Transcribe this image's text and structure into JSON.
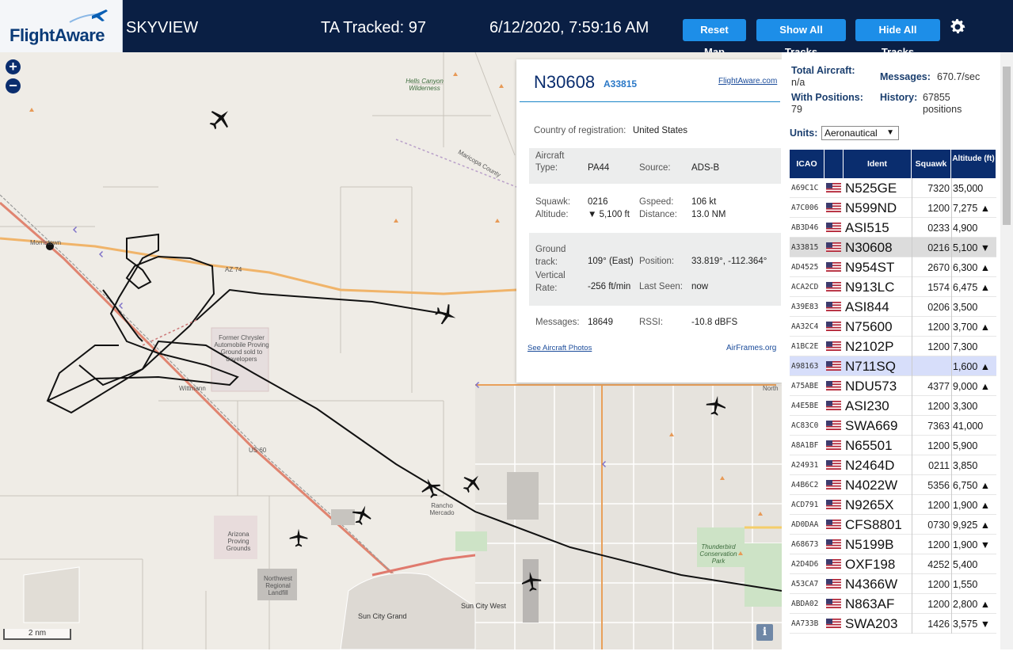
{
  "header": {
    "logo_text": "FlightAware",
    "app_name": "SKYVIEW",
    "tracked": "TA Tracked: 97",
    "datetime": "6/12/2020, 7:59:16 AM",
    "reset_map": "Reset Map",
    "show_all": "Show All Tracks",
    "hide_all": "Hide All Tracks"
  },
  "map": {
    "zoom_in": "+",
    "zoom_out": "−",
    "scale_label": "2 nm",
    "info_label": "i",
    "labels": {
      "hells_canyon": "Hells Canyon Wilderness",
      "morristown": "Morristown",
      "az74": "AZ 74",
      "proving_ground": "Former Chrysler Automobile Proving Ground sold to developers",
      "wittmann": "Wittmann",
      "us60": "US 60",
      "arizona_proving": "Arizona Proving Grounds",
      "rancho": "Rancho Mercado",
      "northwest_park": "Northwest Regional Landfill",
      "sun_city_grand": "Sun City Grand",
      "sun_city_west": "Sun City West",
      "thunderbird": "Thunderbird Conservation Park",
      "north": "North",
      "maricopa": "Maricopa County"
    }
  },
  "popup": {
    "ident": "N30608",
    "hex": "A33815",
    "fa_link": "FlightAware.com",
    "country_label": "Country of registration:",
    "country": "United States",
    "aircraft_type_label": "Aircraft Type:",
    "aircraft_type": "PA44",
    "source_label": "Source:",
    "source": "ADS-B",
    "squawk_label": "Squawk:",
    "squawk": "0216",
    "gspeed_label": "Gspeed:",
    "gspeed": "106 kt",
    "altitude_label": "Altitude:",
    "altitude": "▼ 5,100 ft",
    "distance_label": "Distance:",
    "distance": "13.0 NM",
    "ground_track_label": "Ground track:",
    "ground_track": "109° (East)",
    "position_label": "Position:",
    "position": "33.819°, -112.364°",
    "vertical_rate_label": "Vertical Rate:",
    "vertical_rate": "-256 ft/min",
    "last_seen_label": "Last Seen:",
    "last_seen": "now",
    "messages_label": "Messages:",
    "messages": "18649",
    "rssi_label": "RSSI:",
    "rssi": "-10.8 dBFS",
    "photos_link": "See Aircraft Photos",
    "airframes_link": "AirFrames.org"
  },
  "stats": {
    "total_label": "Total Aircraft:",
    "total_value": "n/a",
    "messages_label": "Messages:",
    "messages_value": "670.7/sec",
    "positions_label": "With Positions:",
    "positions_value": "79",
    "history_label": "History:",
    "history_value": "67855 positions",
    "units_label": "Units:",
    "units_value": "Aeronautical"
  },
  "table": {
    "headers": {
      "icao": "ICAO",
      "ident": "Ident",
      "squawk": "Squawk",
      "altitude": "Altitude (ft)"
    },
    "rows": [
      {
        "icao": "A69C1C",
        "ident": "N525GE",
        "squawk": "7320",
        "alt": "35,000",
        "state": ""
      },
      {
        "icao": "A7C006",
        "ident": "N599ND",
        "squawk": "1200",
        "alt": "7,275 ▲",
        "state": ""
      },
      {
        "icao": "AB3D46",
        "ident": "ASI515",
        "squawk": "0233",
        "alt": "4,900",
        "state": ""
      },
      {
        "icao": "A33815",
        "ident": "N30608",
        "squawk": "0216",
        "alt": "5,100 ▼",
        "state": "sel"
      },
      {
        "icao": "AD4525",
        "ident": "N954ST",
        "squawk": "2670",
        "alt": "6,300 ▲",
        "state": ""
      },
      {
        "icao": "ACA2CD",
        "ident": "N913LC",
        "squawk": "1574",
        "alt": "6,475 ▲",
        "state": ""
      },
      {
        "icao": "A39E83",
        "ident": "ASI844",
        "squawk": "0206",
        "alt": "3,500",
        "state": ""
      },
      {
        "icao": "AA32C4",
        "ident": "N75600",
        "squawk": "1200",
        "alt": "3,700 ▲",
        "state": ""
      },
      {
        "icao": "A1BC2E",
        "ident": "N2102P",
        "squawk": "1200",
        "alt": "7,300",
        "state": ""
      },
      {
        "icao": "A98163",
        "ident": "N711SQ",
        "squawk": "",
        "alt": "1,600 ▲",
        "state": "hl"
      },
      {
        "icao": "A75ABE",
        "ident": "NDU573",
        "squawk": "4377",
        "alt": "9,000 ▲",
        "state": ""
      },
      {
        "icao": "A4E5BE",
        "ident": "ASI230",
        "squawk": "1200",
        "alt": "3,300",
        "state": ""
      },
      {
        "icao": "AC83C0",
        "ident": "SWA669",
        "squawk": "7363",
        "alt": "41,000",
        "state": ""
      },
      {
        "icao": "A8A1BF",
        "ident": "N65501",
        "squawk": "1200",
        "alt": "5,900",
        "state": ""
      },
      {
        "icao": "A24931",
        "ident": "N2464D",
        "squawk": "0211",
        "alt": "3,850",
        "state": ""
      },
      {
        "icao": "A4B6C2",
        "ident": "N4022W",
        "squawk": "5356",
        "alt": "6,750 ▲",
        "state": ""
      },
      {
        "icao": "ACD791",
        "ident": "N9265X",
        "squawk": "1200",
        "alt": "1,900 ▲",
        "state": ""
      },
      {
        "icao": "AD0DAA",
        "ident": "CFS8801",
        "squawk": "0730",
        "alt": "9,925 ▲",
        "state": ""
      },
      {
        "icao": "A68673",
        "ident": "N5199B",
        "squawk": "1200",
        "alt": "1,900 ▼",
        "state": ""
      },
      {
        "icao": "A2D4D6",
        "ident": "OXF198",
        "squawk": "4252",
        "alt": "5,400",
        "state": ""
      },
      {
        "icao": "A53CA7",
        "ident": "N4366W",
        "squawk": "1200",
        "alt": "1,550",
        "state": ""
      },
      {
        "icao": "ABDA02",
        "ident": "N863AF",
        "squawk": "1200",
        "alt": "2,800 ▲",
        "state": ""
      },
      {
        "icao": "AA733B",
        "ident": "SWA203",
        "squawk": "1426",
        "alt": "3,575 ▼",
        "state": ""
      }
    ]
  },
  "colors": {
    "header_bg": "#0a1f44",
    "button_blue": "#1d8ee8",
    "table_header": "#0a2d6e",
    "selected_row": "#dcdcdc",
    "highlight_row": "#d7defa"
  }
}
